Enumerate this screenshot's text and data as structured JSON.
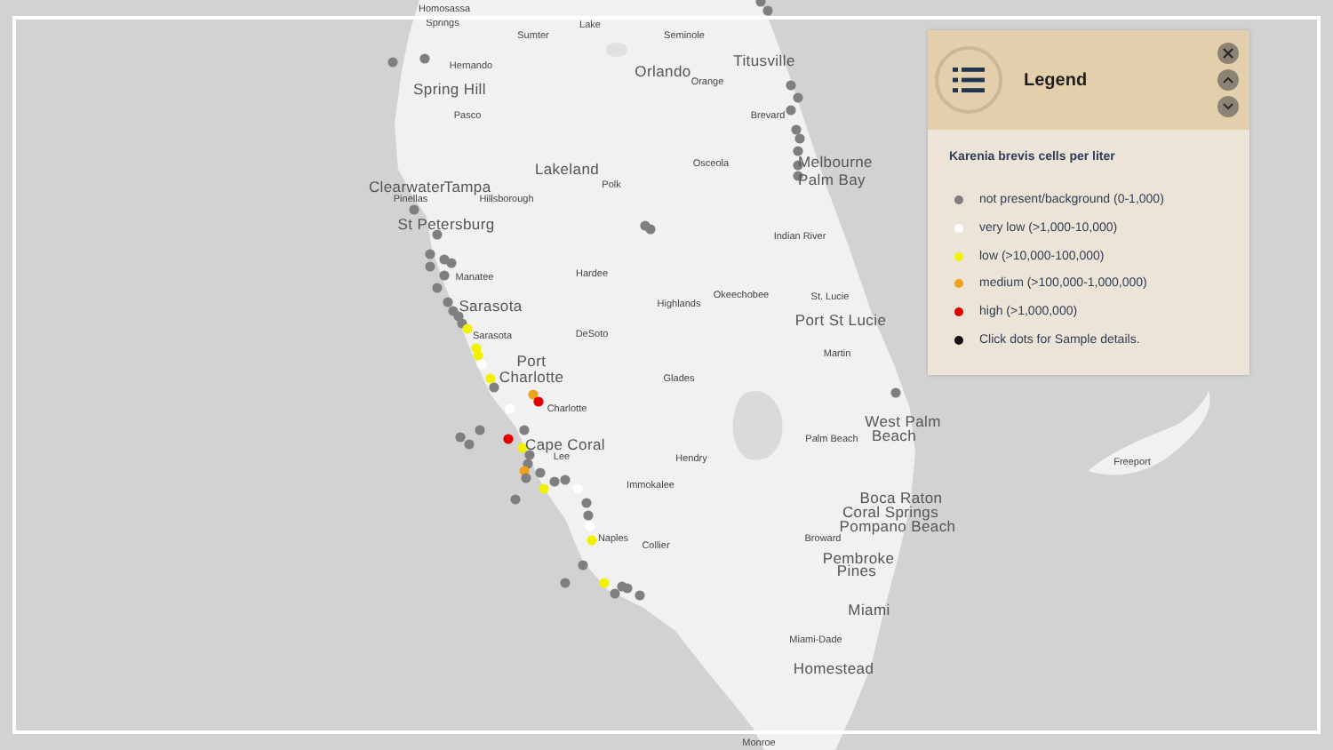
{
  "map": {
    "labels": [
      {
        "text": "Homosassa",
        "kind": "county"
      },
      {
        "text": "Springs",
        "kind": "county"
      },
      {
        "text": "Lake",
        "kind": "county"
      },
      {
        "text": "Sumter",
        "kind": "county"
      },
      {
        "text": "Seminole",
        "kind": "county"
      },
      {
        "text": "Hernando",
        "kind": "county"
      },
      {
        "text": "Orlando",
        "kind": "city"
      },
      {
        "text": "Titusville",
        "kind": "city"
      },
      {
        "text": "Orange",
        "kind": "county"
      },
      {
        "text": "Spring Hill",
        "kind": "city"
      },
      {
        "text": "Pasco",
        "kind": "county"
      },
      {
        "text": "Brevard",
        "kind": "county"
      },
      {
        "text": "Lakeland",
        "kind": "city"
      },
      {
        "text": "Osceola",
        "kind": "county"
      },
      {
        "text": "Melbourne",
        "kind": "city"
      },
      {
        "text": "Clearwater",
        "kind": "city"
      },
      {
        "text": "Tampa",
        "kind": "city"
      },
      {
        "text": "Polk",
        "kind": "county"
      },
      {
        "text": "Palm Bay",
        "kind": "city"
      },
      {
        "text": "Pinellas",
        "kind": "county"
      },
      {
        "text": "Hillsborough",
        "kind": "county"
      },
      {
        "text": "St Petersburg",
        "kind": "city"
      },
      {
        "text": "Indian River",
        "kind": "county"
      },
      {
        "text": "Manatee",
        "kind": "county"
      },
      {
        "text": "Hardee",
        "kind": "county"
      },
      {
        "text": "Sarasota",
        "kind": "city"
      },
      {
        "text": "Highlands",
        "kind": "county"
      },
      {
        "text": "Okeechobee",
        "kind": "county"
      },
      {
        "text": "St. Lucie",
        "kind": "county"
      },
      {
        "text": "Port St Lucie",
        "kind": "city"
      },
      {
        "text": "Sarasota",
        "kind": "county"
      },
      {
        "text": "DeSoto",
        "kind": "county"
      },
      {
        "text": "Martin",
        "kind": "county"
      },
      {
        "text": "Port",
        "kind": "city"
      },
      {
        "text": "Charlotte",
        "kind": "city"
      },
      {
        "text": "Glades",
        "kind": "county"
      },
      {
        "text": "Charlotte",
        "kind": "county"
      },
      {
        "text": "West Palm",
        "kind": "city"
      },
      {
        "text": "Cape Coral",
        "kind": "city"
      },
      {
        "text": "Palm Beach",
        "kind": "county"
      },
      {
        "text": "Beach",
        "kind": "city"
      },
      {
        "text": "Lee",
        "kind": "county"
      },
      {
        "text": "Hendry",
        "kind": "county"
      },
      {
        "text": "Freeport",
        "kind": "county"
      },
      {
        "text": "Immokalee",
        "kind": "county"
      },
      {
        "text": "Boca Raton",
        "kind": "city"
      },
      {
        "text": "Coral Springs",
        "kind": "city"
      },
      {
        "text": "Pompano Beach",
        "kind": "city"
      },
      {
        "text": "Naples",
        "kind": "county"
      },
      {
        "text": "Collier",
        "kind": "county"
      },
      {
        "text": "Broward",
        "kind": "county"
      },
      {
        "text": "Pembroke",
        "kind": "city"
      },
      {
        "text": "Pines",
        "kind": "city"
      },
      {
        "text": "Miami",
        "kind": "city"
      },
      {
        "text": "Miami-Dade",
        "kind": "county"
      },
      {
        "text": "Homestead",
        "kind": "city"
      },
      {
        "text": "Monroe",
        "kind": "county"
      }
    ]
  },
  "legend": {
    "title": "Legend",
    "subtitle": "Karenia brevis cells per liter",
    "items": [
      {
        "label": "not present/background (0-1,000)",
        "color": "#7f7f7f"
      },
      {
        "label": "very low (>1,000-10,000)",
        "color": "#ffffff"
      },
      {
        "label": "low (>10,000-100,000)",
        "color": "#f2f200"
      },
      {
        "label": "medium (>100,000-1,000,000)",
        "color": "#eea21c"
      },
      {
        "label": "high (>1,000,000)",
        "color": "#e00000"
      },
      {
        "label": "Click dots for Sample details.",
        "color": "#111111"
      }
    ]
  }
}
